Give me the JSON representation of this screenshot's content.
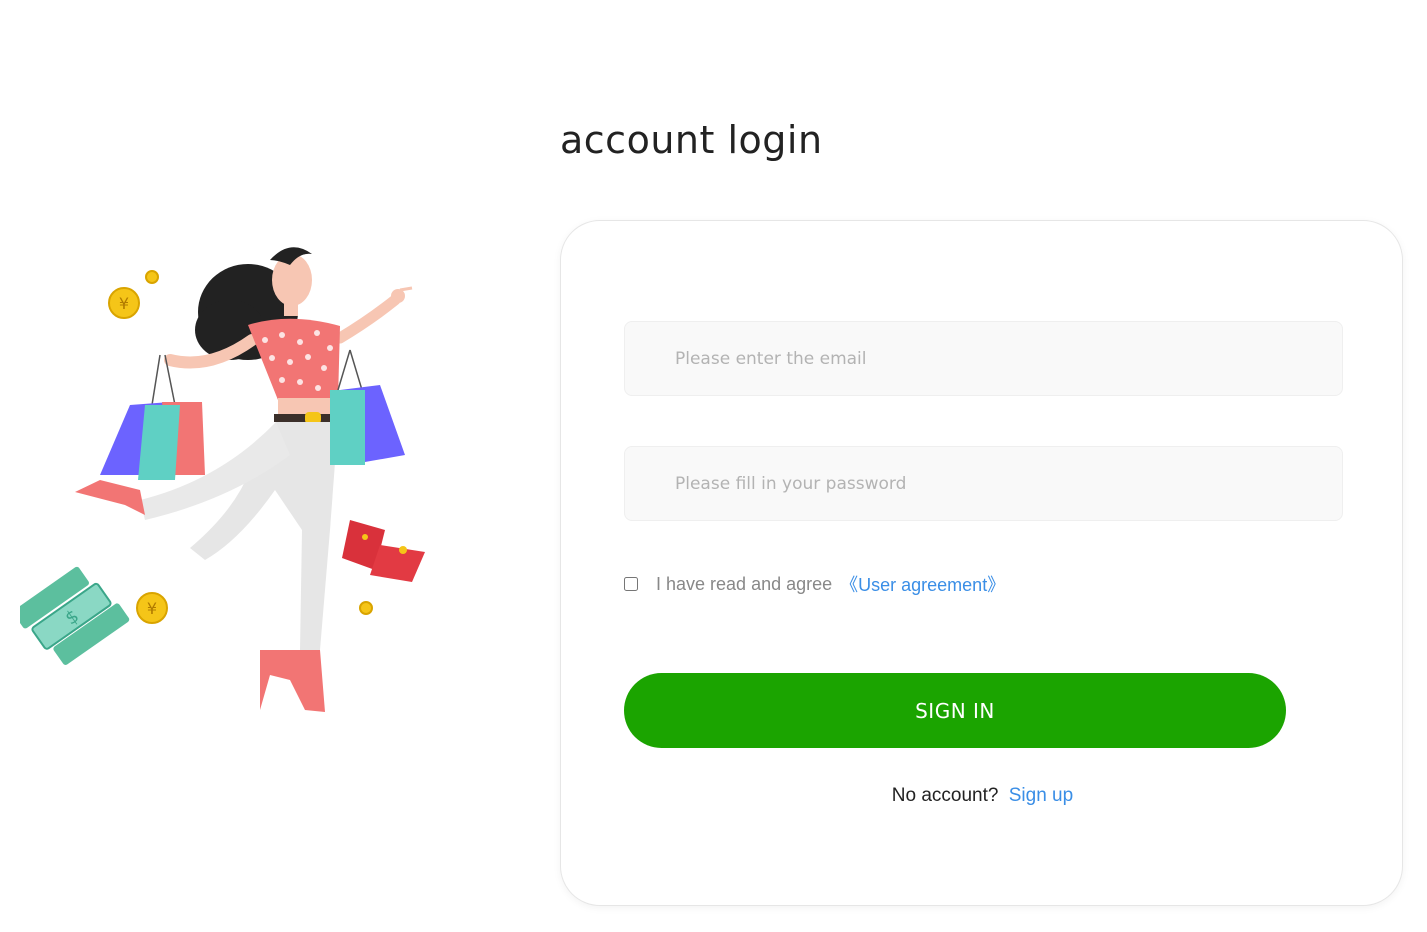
{
  "page": {
    "title": "account login"
  },
  "form": {
    "email_placeholder": "Please enter the email",
    "email_value": "",
    "password_placeholder": "Please fill in your password",
    "password_value": "",
    "agreement_checked": false,
    "agreement_text": "I have read and agree",
    "agreement_link": "《User agreement》",
    "submit_label": "SIGN IN",
    "signup_prompt": "No account?",
    "signup_link": "Sign up"
  },
  "illustration": {
    "icon": "shopping-woman-illustration"
  },
  "colors": {
    "primary_button": "#1ba400",
    "link": "#3a8ee6",
    "field_background": "#f9f9f9"
  }
}
